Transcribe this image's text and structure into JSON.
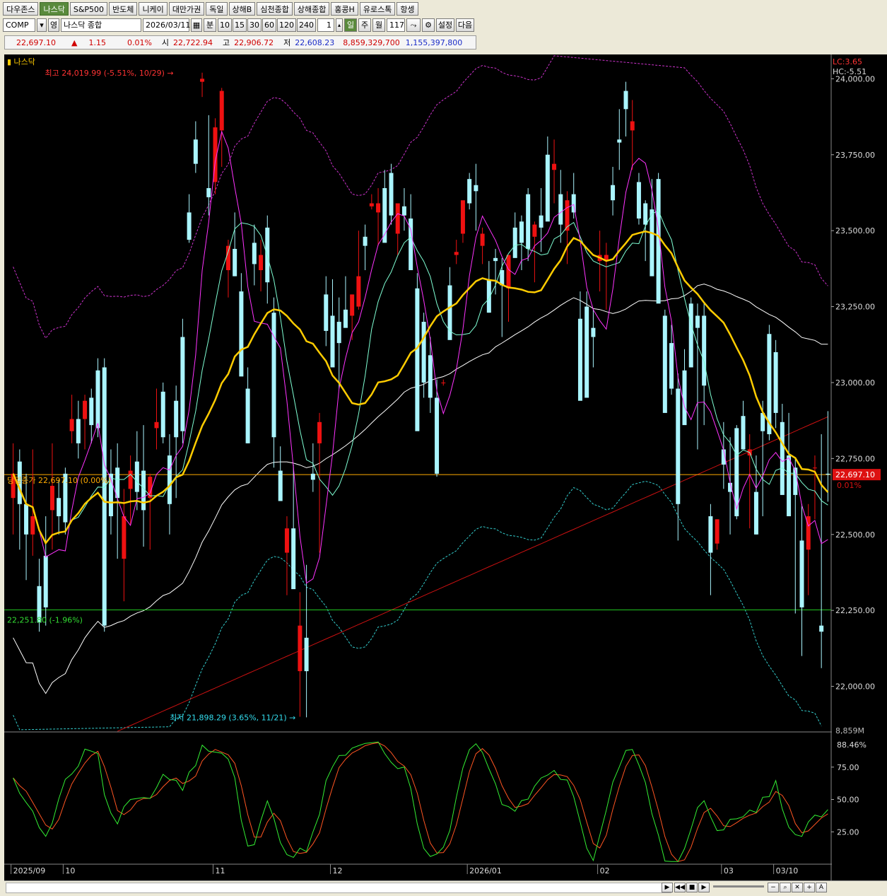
{
  "tabs": [
    "다우존스",
    "나스닥",
    "S&P500",
    "반도체",
    "니케이",
    "대만가권",
    "독일",
    "상해B",
    "심천종합",
    "상해종합",
    "홍콩H",
    "유로스톡",
    "항셍"
  ],
  "active_tab": 1,
  "toolbar": {
    "symbol": "COMP",
    "symbol_kind": "영",
    "name": "나스닥 종합",
    "date": "2026/03/11",
    "period_minute": "분",
    "intervals": [
      "10",
      "15",
      "30",
      "60",
      "120",
      "240"
    ],
    "count_input": "1",
    "day": "일",
    "week": "주",
    "month": "월",
    "bars": "117",
    "settings": "설정",
    "next": "다음"
  },
  "quote": {
    "price": "22,697.10",
    "change_arrow": "▲",
    "change": "1.15",
    "change_pct": "0.01%",
    "open_label": "시",
    "open": "22,722.94",
    "high_label": "고",
    "high": "22,906.72",
    "low_label": "저",
    "low": "22,608.23",
    "volume": "8,859,329,700",
    "amount": "1,155,397,800"
  },
  "chart_data": {
    "type": "candlestick",
    "title": "나스닥",
    "ylim": [
      21850,
      24080
    ],
    "y_ticks": [
      22000,
      22250,
      22500,
      22750,
      23000,
      23250,
      23500,
      23750,
      24000
    ],
    "y_tick_labels": [
      "22,000.00",
      "22,250.00",
      "22,500.00",
      "22,750.00",
      "23,000.00",
      "23,250.00",
      "23,500.00",
      "23,750.00",
      "24,000.00"
    ],
    "x_labels": [
      {
        "label": "2025/09",
        "index": 0
      },
      {
        "label": "10",
        "index": 8
      },
      {
        "label": "11",
        "index": 31
      },
      {
        "label": "12",
        "index": 49
      },
      {
        "label": "2026/01",
        "index": 70
      },
      {
        "label": "02",
        "index": 90
      },
      {
        "label": "03",
        "index": 109
      },
      {
        "label": "03/10",
        "index": 117
      }
    ],
    "top_right": [
      "LC:3.65",
      "HC:-5.51"
    ],
    "current_price_label": "22,697.10",
    "current_price_pct": "0.01%",
    "prev_close_text": "당일종가 22,697.10 (0.00%)",
    "prev_close_value": 22697.1,
    "support_text": "22,251.80 (-1.96%)",
    "support_value": 22251.8,
    "high_annotation": "최고 24,019.99 (-5.51%, 10/29)",
    "high_value": 24019.99,
    "high_index": 27,
    "low_annotation": "최저 21,898.29 (3.65%, 11/21)",
    "low_value": 21898.29,
    "low_index": 44,
    "axis_partial_label": "8,859M",
    "candles": [
      [
        22620,
        22800,
        22500,
        22700
      ],
      [
        22740,
        22780,
        22450,
        22600
      ],
      [
        22600,
        22700,
        22350,
        22500
      ],
      [
        22500,
        22780,
        22430,
        22560
      ],
      [
        22330,
        22420,
        22180,
        22210
      ],
      [
        22430,
        22560,
        22200,
        22260
      ],
      [
        22580,
        22800,
        22450,
        22660
      ],
      [
        22620,
        22680,
        22500,
        22560
      ],
      [
        22700,
        22720,
        22500,
        22540
      ],
      [
        22840,
        22960,
        22800,
        22880
      ],
      [
        22880,
        22940,
        22750,
        22800
      ],
      [
        22880,
        22960,
        22780,
        22940
      ],
      [
        22950,
        22980,
        22800,
        22860
      ],
      [
        23040,
        23080,
        22820,
        22850
      ],
      [
        23050,
        23080,
        22180,
        22200
      ],
      [
        22700,
        22780,
        22500,
        22560
      ],
      [
        22720,
        22800,
        22420,
        22620
      ],
      [
        22420,
        22650,
        22280,
        22560
      ],
      [
        22650,
        22760,
        22530,
        22710
      ],
      [
        22740,
        22840,
        22580,
        22640
      ],
      [
        22710,
        22860,
        22460,
        22580
      ],
      [
        22620,
        22700,
        22450,
        22690
      ],
      [
        22850,
        22980,
        22780,
        22870
      ],
      [
        22970,
        23000,
        22800,
        22820
      ],
      [
        22760,
        22830,
        22500,
        22600
      ],
      [
        22940,
        22990,
        22620,
        22820
      ],
      [
        23150,
        23210,
        22800,
        22840
      ],
      [
        23560,
        23620,
        23460,
        23470
      ],
      [
        23800,
        23860,
        23690,
        23720
      ],
      [
        23990,
        24020,
        23940,
        24000
      ],
      [
        23640,
        23880,
        23550,
        23610
      ],
      [
        23660,
        23870,
        23620,
        23840
      ],
      [
        23830,
        23970,
        23710,
        23960
      ],
      [
        23370,
        23470,
        23280,
        23450
      ],
      [
        23440,
        23560,
        23350,
        23350
      ],
      [
        23300,
        23360,
        23050,
        23020
      ],
      [
        22980,
        23050,
        22800,
        22800
      ],
      [
        23460,
        23520,
        23320,
        23390
      ],
      [
        23370,
        23470,
        23300,
        23420
      ],
      [
        23510,
        23550,
        23260,
        23330
      ],
      [
        23230,
        23280,
        22720,
        22820
      ],
      [
        22710,
        22790,
        22640,
        22610
      ],
      [
        22440,
        22560,
        22300,
        22520
      ],
      [
        22520,
        22730,
        22340,
        22320
      ],
      [
        22050,
        22310,
        21900,
        22200
      ],
      [
        22160,
        22400,
        21898,
        22050
      ],
      [
        22700,
        22800,
        22640,
        22680
      ],
      [
        22800,
        22900,
        22440,
        22870
      ],
      [
        23290,
        23350,
        23120,
        23170
      ],
      [
        23220,
        23340,
        23060,
        23050
      ],
      [
        23200,
        23280,
        22980,
        23130
      ],
      [
        23240,
        23350,
        23180,
        23180
      ],
      [
        23220,
        23290,
        23140,
        23290
      ],
      [
        23250,
        23500,
        23240,
        23350
      ],
      [
        23480,
        23520,
        23370,
        23450
      ],
      [
        23580,
        23620,
        23570,
        23590
      ],
      [
        23560,
        23640,
        23450,
        23590
      ],
      [
        23640,
        23700,
        23560,
        23460
      ],
      [
        23690,
        23720,
        23520,
        23550
      ],
      [
        23490,
        23590,
        23420,
        23590
      ],
      [
        23580,
        23640,
        23500,
        23550
      ],
      [
        23540,
        23620,
        23460,
        23370
      ],
      [
        23310,
        23360,
        22880,
        22840
      ],
      [
        23200,
        23230,
        22950,
        23000
      ],
      [
        23090,
        23150,
        22900,
        22950
      ],
      [
        22950,
        23010,
        22690,
        22700
      ],
      [
        23000,
        23010,
        22990,
        23000
      ],
      [
        23320,
        23380,
        23200,
        23140
      ],
      [
        23420,
        23470,
        23390,
        23430
      ],
      [
        23490,
        23570,
        23460,
        23600
      ],
      [
        23670,
        23690,
        23570,
        23590
      ],
      [
        23650,
        23720,
        23500,
        23630
      ],
      [
        23450,
        23510,
        23390,
        23490
      ],
      [
        23340,
        23400,
        23230,
        23230
      ],
      [
        23410,
        23440,
        23290,
        23400
      ],
      [
        23370,
        23410,
        23150,
        23320
      ],
      [
        23310,
        23420,
        23200,
        23420
      ],
      [
        23510,
        23560,
        23440,
        23410
      ],
      [
        23530,
        23550,
        23370,
        23460
      ],
      [
        23620,
        23640,
        23400,
        23440
      ],
      [
        23480,
        23530,
        23330,
        23520
      ],
      [
        23550,
        23640,
        23430,
        23510
      ],
      [
        23750,
        23810,
        23620,
        23530
      ],
      [
        23700,
        23800,
        23590,
        23720
      ],
      [
        23620,
        23700,
        23460,
        23520
      ],
      [
        23500,
        23630,
        23390,
        23600
      ],
      [
        23620,
        23690,
        23540,
        23560
      ],
      [
        23210,
        23300,
        22990,
        22940
      ],
      [
        23250,
        23300,
        23200,
        22950
      ],
      [
        23180,
        23240,
        23050,
        23150
      ],
      [
        23400,
        23500,
        23300,
        23420
      ],
      [
        23400,
        23460,
        23240,
        23420
      ],
      [
        23650,
        23710,
        23550,
        23600
      ],
      [
        23800,
        23900,
        23700,
        23790
      ],
      [
        23960,
        23990,
        23810,
        23900
      ],
      [
        23830,
        23930,
        23700,
        23860
      ],
      [
        23660,
        23690,
        23520,
        23540
      ],
      [
        23590,
        23600,
        23400,
        23520
      ],
      [
        23570,
        23670,
        23450,
        23350
      ],
      [
        23670,
        23690,
        23460,
        23260
      ],
      [
        23220,
        23240,
        23000,
        22900
      ],
      [
        23130,
        23190,
        22960,
        22980
      ],
      [
        22980,
        23030,
        22480,
        22600
      ],
      [
        23040,
        23110,
        22890,
        22860
      ],
      [
        23260,
        23280,
        23080,
        23050
      ],
      [
        23220,
        23260,
        22780,
        23180
      ],
      [
        23220,
        23260,
        22860,
        22990
      ],
      [
        22560,
        22600,
        22300,
        22440
      ],
      [
        22470,
        22550,
        22450,
        22550
      ],
      [
        22780,
        22870,
        22650,
        22730
      ],
      [
        22670,
        22820,
        22500,
        22640
      ],
      [
        22850,
        22860,
        22550,
        22560
      ],
      [
        22890,
        22940,
        22810,
        22780
      ],
      [
        22760,
        22830,
        22520,
        22780
      ],
      [
        22640,
        22760,
        22500,
        22500
      ],
      [
        22900,
        22940,
        22560,
        22840
      ],
      [
        23160,
        23190,
        22810,
        22830
      ],
      [
        23100,
        23140,
        22850,
        22900
      ],
      [
        22870,
        22930,
        22680,
        22630
      ],
      [
        22760,
        22900,
        22570,
        22560
      ],
      [
        22720,
        22750,
        22240,
        22630
      ],
      [
        22480,
        22600,
        22100,
        22260
      ],
      [
        22450,
        22600,
        22300,
        22560
      ],
      [
        22720,
        22760,
        22550,
        22720
      ],
      [
        22200,
        22830,
        22060,
        22180
      ],
      [
        22700,
        22906,
        22608,
        22697
      ]
    ],
    "moving_averages": [
      {
        "name": "MA20",
        "color": "#ffcc00",
        "width": 2.5
      },
      {
        "name": "MA60",
        "color": "#ffffff",
        "width": 1
      },
      {
        "name": "MA120",
        "color": "#cc1111",
        "width": 1
      },
      {
        "name": "MA5",
        "color": "#ff33ff",
        "width": 1
      },
      {
        "name": "MA10",
        "color": "#7fffd4",
        "width": 1
      }
    ],
    "envelope_upper_color": "#cc33cc",
    "envelope_lower_color": "#33cccc",
    "stochastic": {
      "ylim": [
        0,
        100
      ],
      "y_ticks": [
        25,
        50,
        75
      ],
      "y_tick_labels": [
        "25.00",
        "50.00",
        "75.00"
      ],
      "current_label": "88.46%",
      "slow_color": "#ff5522",
      "fast_color": "#33ee33"
    }
  }
}
